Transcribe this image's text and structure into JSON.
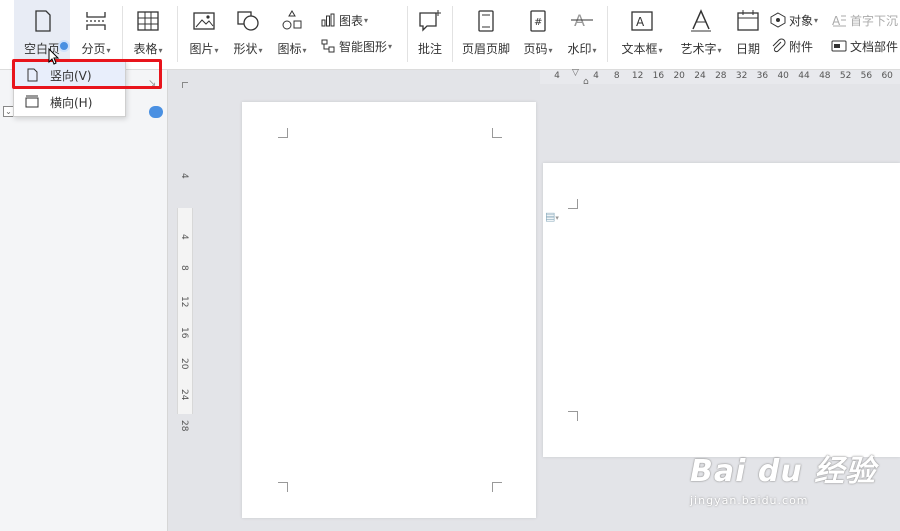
{
  "ribbon": {
    "blank_page": "空白页",
    "page_break": "分页",
    "table": "表格",
    "picture": "图片",
    "shape": "形状",
    "icon": "图标",
    "chart": "图表",
    "smart_art": "智能图形",
    "comment": "批注",
    "header_footer": "页眉页脚",
    "page_number": "页码",
    "watermark": "水印",
    "textbox": "文本框",
    "word_art": "艺术字",
    "date": "日期",
    "object": "对象",
    "attachment": "附件",
    "drop_cap": "首字下沉",
    "doc_parts": "文档部件"
  },
  "dropdown": {
    "items": [
      {
        "label": "竖向(V)"
      },
      {
        "label": "横向(H)"
      }
    ]
  },
  "ruler": {
    "horizontal_ticks": [
      "4",
      "4",
      "8",
      "12",
      "16",
      "20",
      "24",
      "28",
      "32",
      "36",
      "40",
      "44",
      "48",
      "52",
      "56",
      "60"
    ],
    "vertical_ticks": [
      "4",
      "4",
      "8",
      "12",
      "16",
      "20",
      "24",
      "28"
    ]
  },
  "watermark": {
    "main": "Bai du 经验",
    "sub": "jingyan.baidu.com"
  },
  "colors": {
    "highlight_box": "#e8141c",
    "accent": "#4a90e2"
  }
}
